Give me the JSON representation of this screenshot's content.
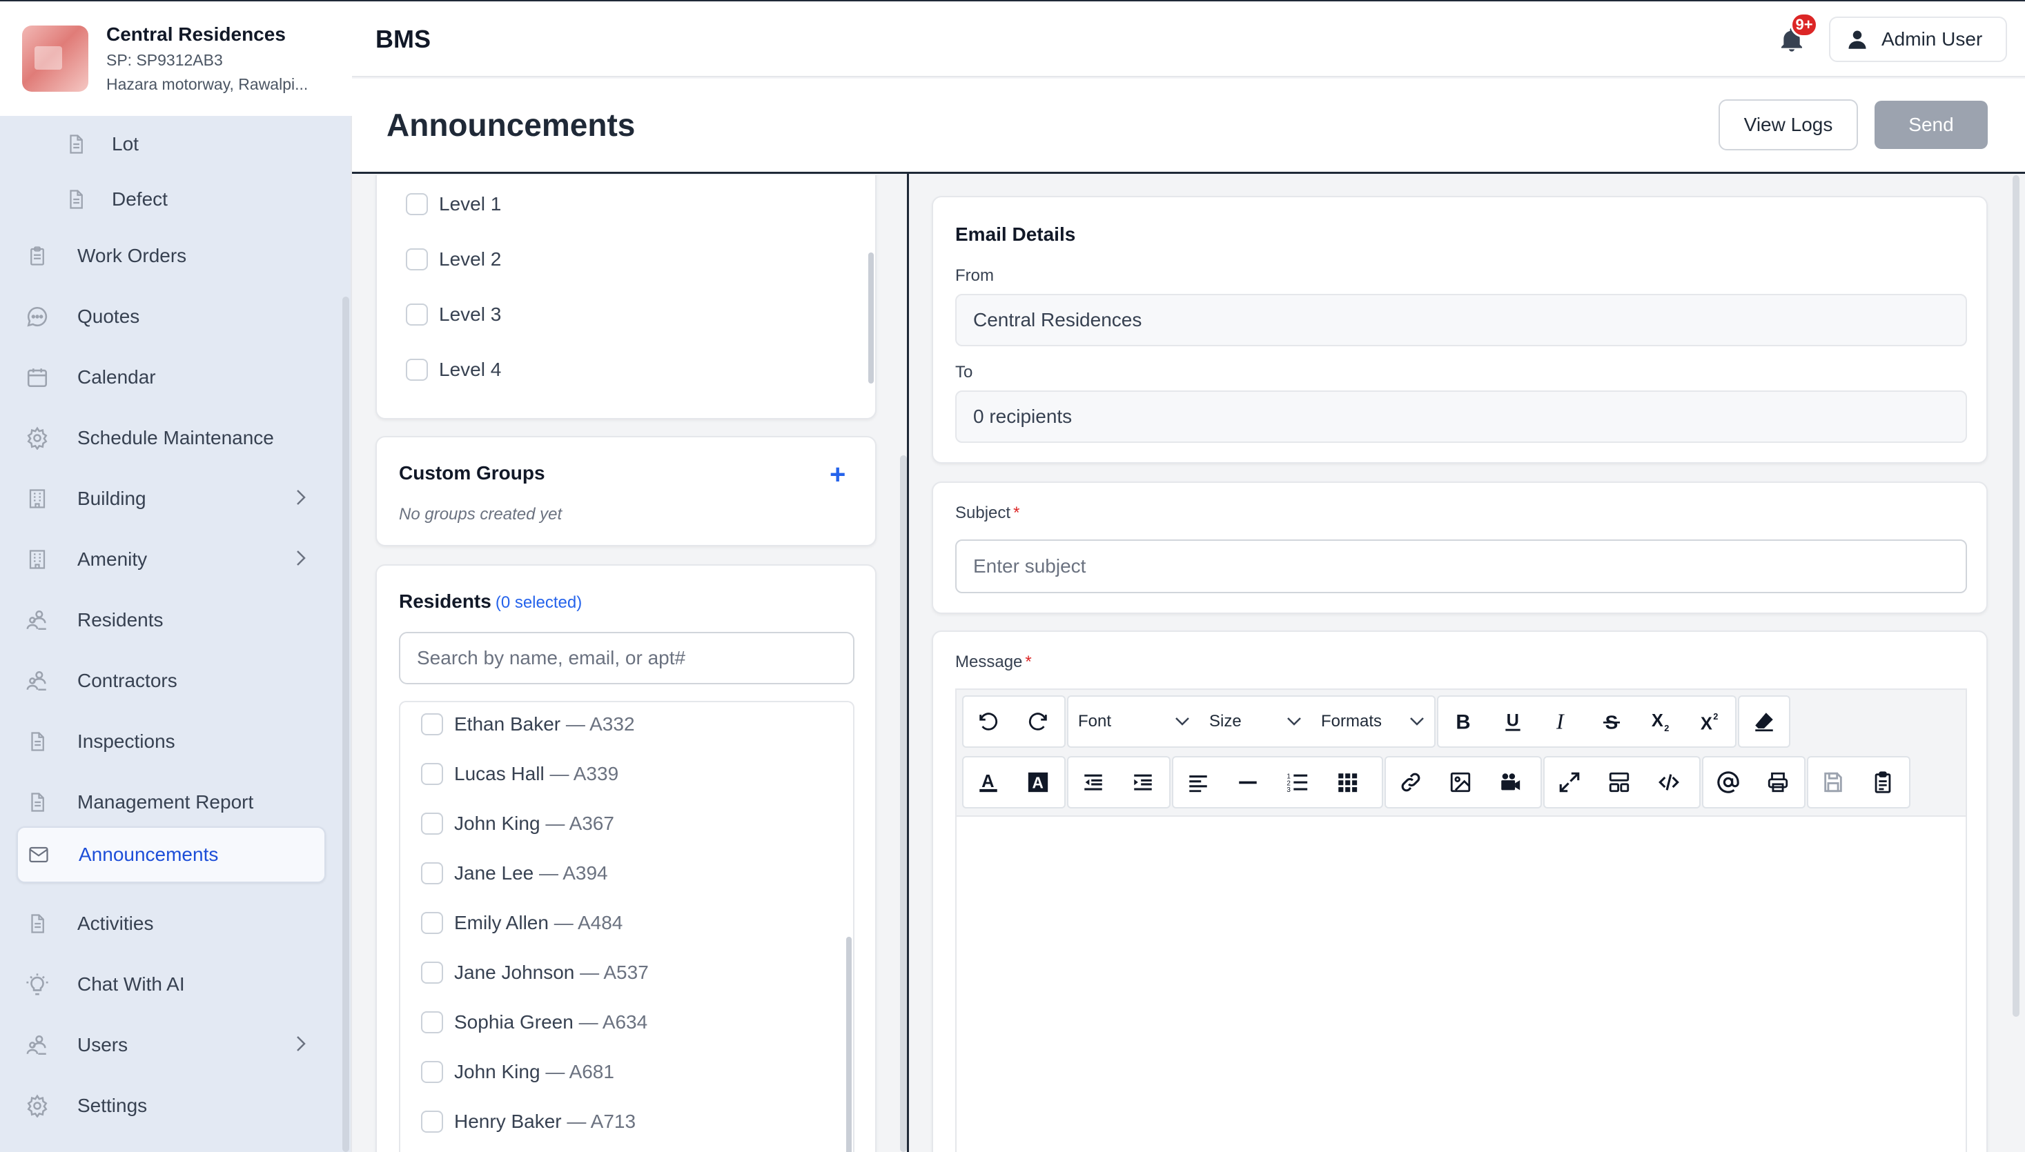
{
  "property": {
    "name": "Central Residences",
    "sp": "SP: SP9312AB3",
    "address": "Hazara motorway, Rawalpi..."
  },
  "sidebar": {
    "items": [
      {
        "label": "Lot",
        "icon": "document-icon",
        "sub": true
      },
      {
        "label": "Defect",
        "icon": "document-icon",
        "sub": true
      },
      {
        "label": "Work Orders",
        "icon": "clipboard-icon"
      },
      {
        "label": "Quotes",
        "icon": "chat-bubble-icon"
      },
      {
        "label": "Calendar",
        "icon": "calendar-icon"
      },
      {
        "label": "Schedule Maintenance",
        "icon": "gear-icon"
      },
      {
        "label": "Building",
        "icon": "building-icon",
        "expandable": true
      },
      {
        "label": "Amenity",
        "icon": "building-icon",
        "expandable": true
      },
      {
        "label": "Residents",
        "icon": "people-icon"
      },
      {
        "label": "Contractors",
        "icon": "people-icon"
      },
      {
        "label": "Inspections",
        "icon": "document-icon"
      },
      {
        "label": "Management Report",
        "icon": "document-icon"
      },
      {
        "label": "Announcements",
        "icon": "mail-icon",
        "active": true
      },
      {
        "label": "Activities",
        "icon": "document-icon"
      },
      {
        "label": "Chat With AI",
        "icon": "lightbulb-icon"
      },
      {
        "label": "Users",
        "icon": "people-icon",
        "expandable": true
      },
      {
        "label": "Settings",
        "icon": "gear-icon"
      }
    ]
  },
  "topbar": {
    "brand": "BMS",
    "notification_badge": "9+",
    "user_name": "Admin User"
  },
  "page": {
    "title": "Announcements",
    "view_logs_label": "View Logs",
    "send_label": "Send"
  },
  "levels": [
    "Level 1",
    "Level 2",
    "Level 3",
    "Level 4"
  ],
  "custom_groups": {
    "title": "Custom Groups",
    "empty_text": "No groups created yet"
  },
  "residents": {
    "title": "Residents",
    "selected_count": "(0 selected)",
    "search_placeholder": "Search by name, email, or apt#",
    "list": [
      {
        "name": "Ethan Baker",
        "apt": "— A332"
      },
      {
        "name": "Lucas Hall",
        "apt": "— A339"
      },
      {
        "name": "John King",
        "apt": "— A367"
      },
      {
        "name": "Jane Lee",
        "apt": "— A394"
      },
      {
        "name": "Emily Allen",
        "apt": "— A484"
      },
      {
        "name": "Jane Johnson",
        "apt": "— A537"
      },
      {
        "name": "Sophia Green",
        "apt": "— A634"
      },
      {
        "name": "John King",
        "apt": "— A681"
      },
      {
        "name": "Henry Baker",
        "apt": "— A713"
      }
    ]
  },
  "email": {
    "title": "Email Details",
    "from_label": "From",
    "from_value": "Central Residences",
    "to_label": "To",
    "to_value": "0 recipients",
    "subject_label": "Subject",
    "subject_placeholder": "Enter subject",
    "message_label": "Message",
    "required_mark": "*"
  },
  "editor": {
    "font_label": "Font",
    "size_label": "Size",
    "formats_label": "Formats"
  },
  "colors": {
    "accent": "#2563eb",
    "badge": "#dc2626",
    "send_disabled": "#9ca3af",
    "sidebar_bg": "#e3e9f3"
  }
}
